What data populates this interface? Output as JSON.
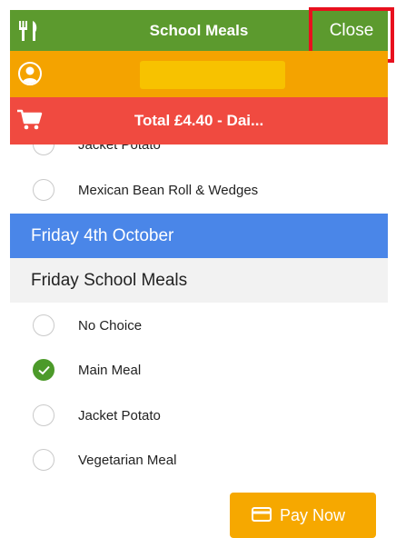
{
  "header": {
    "title": "School Meals",
    "close_label": "Close",
    "icon": "fork-knife-icon",
    "color": "#5c9a2e"
  },
  "userbar": {
    "icon": "user-icon",
    "color": "#f4a300"
  },
  "totalbar": {
    "icon": "cart-icon",
    "text": "Total £4.40 - Dai...",
    "color": "#f04a40"
  },
  "options_top": [
    {
      "label": "Jacket Potato",
      "checked": false
    },
    {
      "label": "Mexican Bean Roll & Wedges",
      "checked": false
    }
  ],
  "day_header": "Friday 4th October",
  "section_header": "Friday School Meals",
  "options": [
    {
      "label": "No Choice",
      "checked": false
    },
    {
      "label": "Main Meal",
      "checked": true
    },
    {
      "label": "Jacket Potato",
      "checked": false
    },
    {
      "label": "Vegetarian Meal",
      "checked": false
    }
  ],
  "pay_button": {
    "label": "Pay Now",
    "icon": "credit-card-icon",
    "color": "#f6a800"
  }
}
